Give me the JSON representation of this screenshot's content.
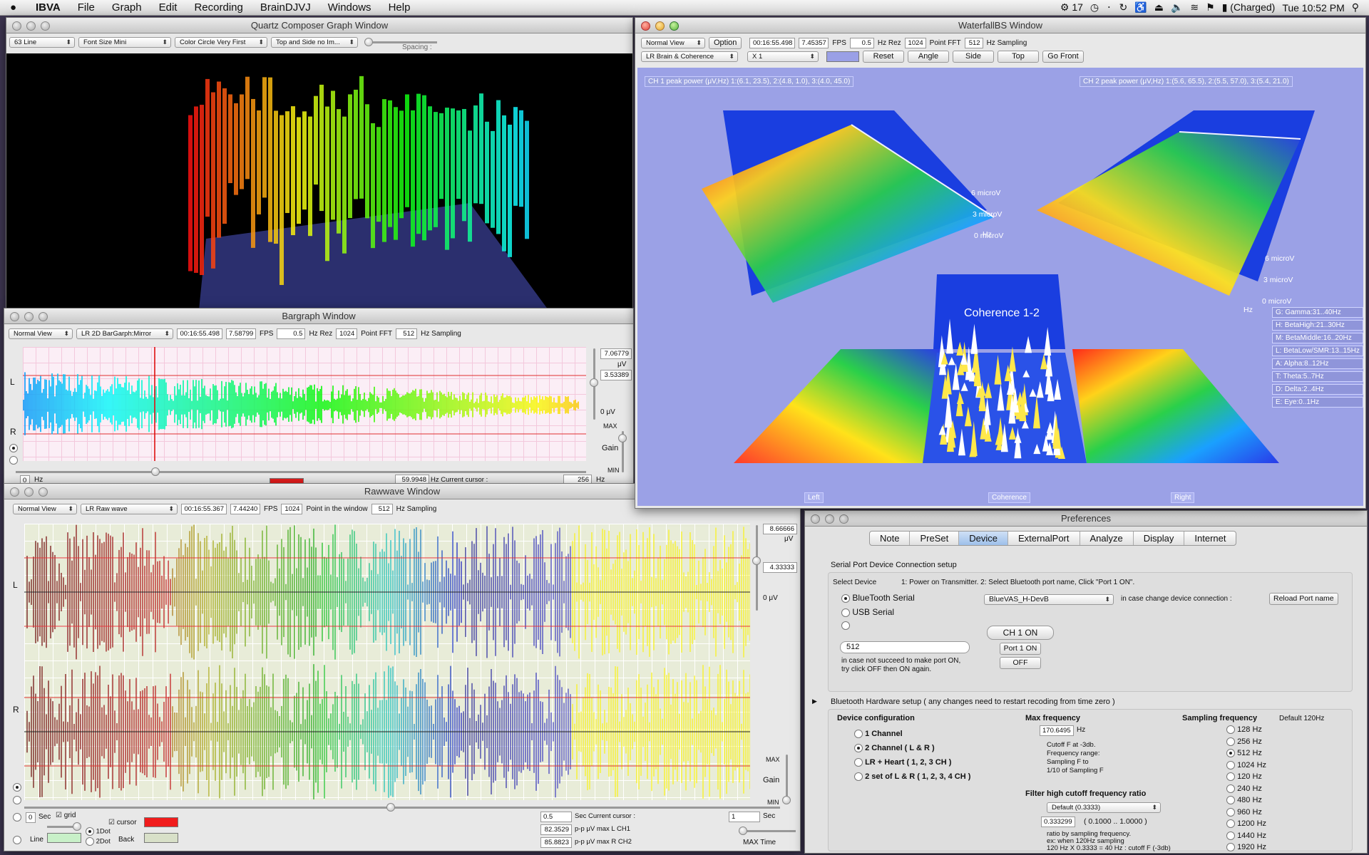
{
  "menubar": {
    "app": "IBVA",
    "items": [
      "File",
      "Graph",
      "Edit",
      "Recording",
      "BrainDJVJ",
      "Windows",
      "Help"
    ],
    "status": {
      "badge": "17",
      "battery": "(Charged)",
      "clock": "Tue 10:52 PM"
    }
  },
  "quartz": {
    "title": "Quartz Composer Graph Window",
    "opt1": "63 Line",
    "opt2": "Font Size Mini",
    "opt3": "Color Circle Very First",
    "opt4": "Top and Side no Im...",
    "spacing_label": "Spacing :"
  },
  "bargraph": {
    "title": "Bargraph Window",
    "view": "Normal View",
    "mode": "LR 2D BarGarph:Mirror",
    "time": "00:16:55.498",
    "fps": "7.58799",
    "fps_label": "FPS",
    "hzrez": "0.5",
    "hzrez_label": "Hz Rez",
    "fft": "1024",
    "fft_label": "Point FFT",
    "sampling": "512",
    "sampling_label": "Hz Sampling",
    "label_l": "L",
    "label_r": "R",
    "scale_top": "7.06779",
    "scale_unit": "μV",
    "scale_mid": "3.53389",
    "scale_zero": "0 μV",
    "max_label": "MAX",
    "gain_label": "Gain",
    "min_label": "MIN",
    "start_hz": "0",
    "hz_unit": "Hz",
    "cursor_value": "59.9948",
    "cursor_label": "Hz Current cursor :",
    "end_value": "256",
    "end_unit": "Hz"
  },
  "rawwave": {
    "title": "Rawwave Window",
    "view": "Normal View",
    "mode": "LR Raw wave",
    "time": "00:16:55.367",
    "fps": "7.44240",
    "fps_label": "FPS",
    "points": "1024",
    "points_label": "Point in the window",
    "sampling": "512",
    "sampling_label": "Hz Sampling",
    "label_l": "L",
    "label_r": "R",
    "scale_top": "8.66666",
    "scale_unit": "μV",
    "scale_mid": "4.33333",
    "scale_zero": "0 μV",
    "max_label": "MAX",
    "gain_label": "Gain",
    "min_label": "MIN",
    "sec_value": "0",
    "sec_label": "Sec",
    "grid_label": "grid",
    "cursor_check": "cursor",
    "line_label": "Line",
    "back_label": "Back",
    "dot1": "1Dot",
    "dot2": "2Dot",
    "cursor_sec": "0.5",
    "cursor_sec_label": "Sec Current cursor :",
    "pp1": "82.3529",
    "pp1_label": "p-p μV max L CH1",
    "pp2": "85.8823",
    "pp2_label": "p-p μV max R CH2",
    "maxtime_val": "1",
    "maxtime_unit": "Sec",
    "maxtime_label": "MAX Time",
    "colors": {
      "cursor": "#f01c1c",
      "line": "#c8f0c8",
      "back": "#d8e0c8"
    }
  },
  "waterfall": {
    "title": "WaterfallBS Window",
    "view": "Normal View",
    "option_btn": "Option",
    "time": "00:16:55.498",
    "fps": "7.45357",
    "fps_label": "FPS",
    "hzrez": "0.5",
    "hzrez_label": "Hz Rez",
    "fft": "1024",
    "fft_label": "Point FFT",
    "sampling": "512",
    "sampling_label": "Hz Sampling",
    "mode": "LR Brain & Coherence",
    "zoom": "X 1",
    "buttons": [
      "Reset",
      "Angle",
      "Side",
      "Top",
      "Go Front"
    ],
    "ch1": "CH 1 peak power (μV,Hz) 1:(6.1, 23.5), 2:(4.8, 1.0), 3:(4.0, 45.0)",
    "ch2": "CH 2 peak power (μV,Hz) 1:(5.6, 65.5), 2:(5.5, 57.0), 3:(5.4, 21.0)",
    "axis": {
      "six": "6 microV",
      "three": "3 microV",
      "zero": "0 microV",
      "hz": "Hz"
    },
    "coherence_title": "Coherence 1-2",
    "bottom": [
      "Left",
      "Coherence",
      "Right"
    ],
    "bands": [
      "G: Gamma:31..40Hz",
      "H: BetaHigh:21..30Hz",
      "M: BetaMiddle:16..20Hz",
      "L: BetaLow/SMR:13..15Hz",
      "A: Alpha:8..12Hz",
      "T: Theta:5..7Hz",
      "D: Delta:2..4Hz",
      "E: Eye:0..1Hz"
    ]
  },
  "prefs": {
    "title": "Preferences",
    "tabs": [
      "Note",
      "PreSet",
      "Device",
      "ExternalPort",
      "Analyze",
      "Display",
      "Internet"
    ],
    "serial_title": "Serial Port Device Connection setup",
    "select_device": "Select Device",
    "step_text": "1: Power on Transmitter.   2: Select Bluetooth port name, Click \"Port 1 ON\".",
    "dev_bt": "BlueTooth Serial",
    "dev_usb": "USB Serial",
    "port_name": "BlueVAS_H-DevB",
    "change_text": "in case change device connection :",
    "reload_btn": "Reload Port name",
    "buffer": "512",
    "ch1_on": "CH 1 ON",
    "port1_on": "Port 1 ON",
    "off": "OFF",
    "hint1": "in case not succeed to make port ON,",
    "hint2": "try click OFF then ON again.",
    "bt_hw": "Bluetooth Hardware setup ( any changes need to restart recoding from time zero )",
    "devconf": "Device configuration",
    "conf": [
      "1 Channel",
      "2 Channel ( L & R )",
      "LR + Heart ( 1, 2, 3 CH )",
      "2 set of L & R ( 1, 2, 3, 4 CH )"
    ],
    "maxfreq": "Max frequency",
    "maxfreq_val": "170.6495",
    "maxfreq_unit": "Hz",
    "cutoff_lines": [
      "Cutoff F at -3db.",
      "Frequency range:",
      "Sampling F to",
      "1/10 of Sampling F"
    ],
    "filter_title": "Filter high cutoff frequency ratio",
    "filter_sel": "Default (0.3333)",
    "ratio_val": "0.333299",
    "ratio_range": "( 0.1000 .. 1.0000 )",
    "ratio_lines": [
      "ratio by sampling frequency.",
      "ex: when 120Hz sampling",
      "120 Hz X 0.3333 = 40 Hz : cutoff F (-3db)"
    ],
    "sampfreq": "Sampling frequency",
    "sampdefault": "Default 120Hz",
    "freqs": [
      "128 Hz",
      "256 Hz",
      "512 Hz",
      "1024 Hz",
      "120 Hz",
      "240 Hz",
      "480 Hz",
      "960 Hz",
      "1200 Hz",
      "1440 Hz",
      "1920 Hz"
    ],
    "selected_freq_index": 2,
    "selected_conf_index": 1
  }
}
